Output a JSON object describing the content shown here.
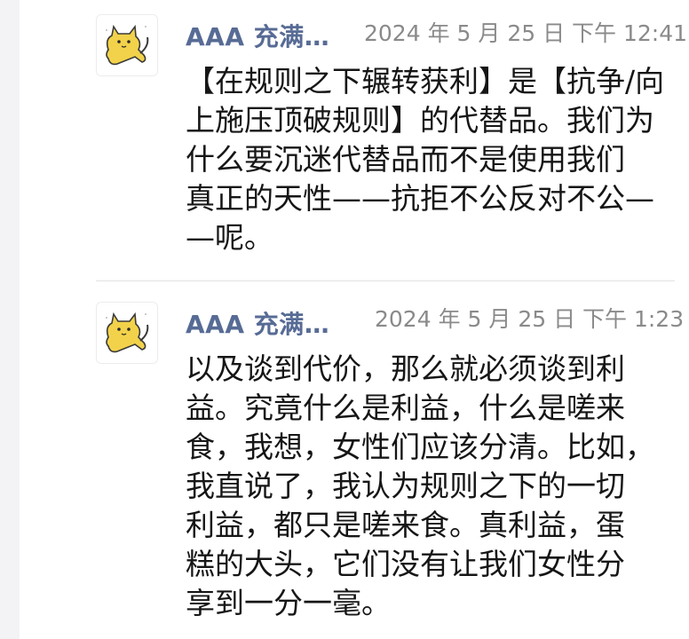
{
  "posts": [
    {
      "author": "AAA 充满…",
      "timestamp": "2024 年 5 月 25 日  下午 12:41",
      "avatar_icon": "cat-icon",
      "lines": [
        "【在规则之下辗转获利】是【抗争/向",
        "上施压顶破规则】的代替品。我们为",
        "什么要沉迷代替品而不是使用我们",
        "真正的天性——抗拒不公反对不公—",
        "—呢。"
      ]
    },
    {
      "author": "AAA 充满…",
      "timestamp": "2024 年 5 月 25 日  下午 1:23",
      "avatar_icon": "cat-icon",
      "lines": [
        "以及谈到代价，那么就必须谈到利",
        "益。究竟什么是利益，什么是嗟来",
        "食，我想，女性们应该分清。比如，",
        "我直说了，我认为规则之下的一切",
        "利益，都只是嗟来食。真利益，蛋",
        "糕的大头，它们没有让我们女性分",
        "享到一分一毫。"
      ]
    }
  ],
  "colors": {
    "author": "#576b95",
    "timestamp": "#8a8a8a",
    "body_text": "#161616",
    "background": "#ffffff",
    "cat_fill": "#f2d24a"
  }
}
